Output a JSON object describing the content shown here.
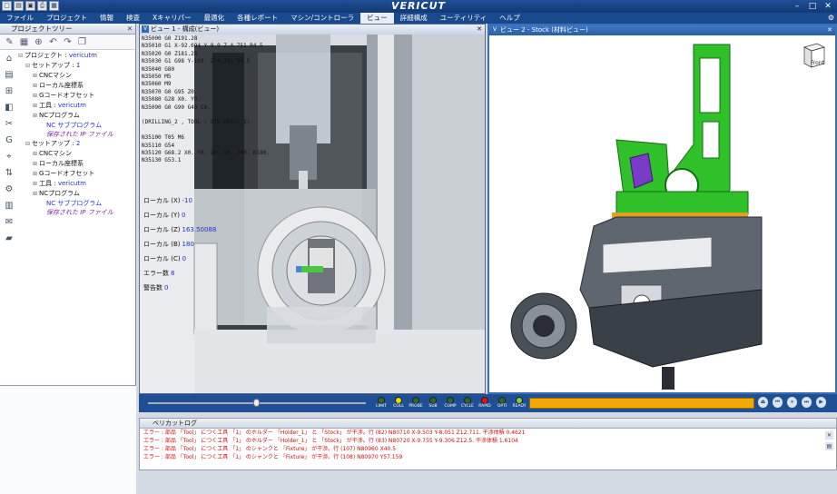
{
  "app": {
    "title": "VERICUT"
  },
  "menu": [
    "ファイル",
    "プロジェクト",
    "情報",
    "検査",
    "Xキャリパー",
    "最適化",
    "各種レポート",
    "マシン/コントローラ",
    "ビュー",
    "詳細構成",
    "ユーティリティ",
    "ヘルプ"
  ],
  "menu_active_index": 8,
  "project_tree": {
    "title": "プロジェクトツリー",
    "items": [
      {
        "label": "プロジェクト : ",
        "value": "vericutm",
        "level": 0,
        "exp": "⊟"
      },
      {
        "label": "セットアップ : ",
        "value": "1",
        "level": 1,
        "exp": "⊟"
      },
      {
        "label": "CNCマシン",
        "value": "",
        "level": 2,
        "exp": "⊞"
      },
      {
        "label": "ローカル座標系",
        "value": "",
        "level": 2,
        "exp": "⊞"
      },
      {
        "label": "Gコードオフセット",
        "value": "",
        "level": 2,
        "exp": "⊞"
      },
      {
        "label": "工具 : ",
        "value": "vericutm",
        "level": 2,
        "exp": "⊞"
      },
      {
        "label": "NCプログラム",
        "value": "",
        "level": 2,
        "exp": "⊞"
      },
      {
        "label": "NC サブプログラム",
        "value": "",
        "level": 3,
        "exp": "",
        "style": "blue"
      },
      {
        "label": "保存された IP ファイル",
        "value": "",
        "level": 3,
        "exp": "",
        "style": "purple"
      },
      {
        "label": "セットアップ : ",
        "value": "2",
        "level": 1,
        "exp": "⊟"
      },
      {
        "label": "CNCマシン",
        "value": "",
        "level": 2,
        "exp": "⊞"
      },
      {
        "label": "ローカル座標系",
        "value": "",
        "level": 2,
        "exp": "⊞"
      },
      {
        "label": "Gコードオフセット",
        "value": "",
        "level": 2,
        "exp": "⊞"
      },
      {
        "label": "工具 : ",
        "value": "vericutm",
        "level": 2,
        "exp": "⊞"
      },
      {
        "label": "NCプログラム",
        "value": "",
        "level": 2,
        "exp": "⊞"
      },
      {
        "label": "NC サブプログラム",
        "value": "",
        "level": 3,
        "exp": "",
        "style": "blue"
      },
      {
        "label": "保存された IP ファイル",
        "value": "",
        "level": 3,
        "exp": "",
        "style": "purple"
      }
    ]
  },
  "view1": {
    "title": "ビュー 1 - 構成(ビュー)",
    "nc_lines": [
      "N35000 G0 Z191.28",
      "N35010 G1 X-92.694 Y-9.9 Z-4.751 R4.5",
      "N35020 G0 Z181.28",
      "N35030 G1 G98 Y-103. Z-4.751 R4.5",
      "N35040 G80",
      "N35050 M5",
      "N35060 M9",
      "N35070 G0 G95 Z0.",
      "N35080 G28 X0. Y0.",
      "N35090 G0 G90 G49 C0.",
      "",
      "(DRILLING_2 , TOOL : STD_DRILL_2)",
      "",
      "N35100 T05 M6",
      "N35110 G54",
      "N35120 G68.2 X0. Y0. Z0. I0. J90. K180.",
      "N35130 G53.1"
    ],
    "readouts": [
      {
        "label": "ローカル (X)",
        "value": "-10"
      },
      {
        "label": "ローカル (Y)",
        "value": "0"
      },
      {
        "label": "ローカル (Z)",
        "value": "163.50088"
      },
      {
        "label": "ローカル (B)",
        "value": "180"
      },
      {
        "label": "ローカル (C)",
        "value": "0"
      },
      {
        "label": "エラー数",
        "value": "8"
      },
      {
        "label": "警告数",
        "value": "0"
      }
    ]
  },
  "view2": {
    "title": "ビュー 2 - Stock (材料ビュー)",
    "cube_label": "Front"
  },
  "playback": {
    "slider_fraction": 0.5,
    "indicators": [
      {
        "label": "LIMIT",
        "color": "#2e6b2e"
      },
      {
        "label": "COLL",
        "color": "#e8e000"
      },
      {
        "label": "PROBE",
        "color": "#2e6b2e"
      },
      {
        "label": "SUB",
        "color": "#2e6b2e"
      },
      {
        "label": "COMP",
        "color": "#2e6b2e"
      },
      {
        "label": "CYCLE",
        "color": "#2e6b2e"
      },
      {
        "label": "RAPID",
        "color": "#e81010"
      },
      {
        "label": "OPTI",
        "color": "#2e6b2e"
      },
      {
        "label": "READY",
        "color": "#7ad040"
      }
    ],
    "progress_color": "#f2a800"
  },
  "log": {
    "title": "ベリカットログ",
    "lines": [
      "エラー : 部品 「Tool」 につく工具 「1」 のホルダー 「Holder_1」 と 「Stock」 が干渉。行 (82) N80710 X-9.503 Y-8.051 Z12.711. 干渉体積 0.4621",
      "エラー : 部品 「Tool」 につく工具 「1」 のホルダー 「Holder_1」 と 「Stock」 が干渉。行 (83) N80720 X-9.755 Y-9.306 Z12.5. 干渉体積 1.6104",
      "エラー : 部品 「Tool」 につく工具 「1」 のシャンクと 「Fixture」 が干渉。行 (107) N80960 X40.5",
      "エラー : 部品 「Tool」 につく工具 「1」 のシャンクと 「Fixture」 が干渉。行 (108) N80970 Y57.159"
    ]
  },
  "colors": {
    "titlebar": "#1f4f95",
    "part_green": "#2fc02a",
    "error_text": "#d21010"
  }
}
